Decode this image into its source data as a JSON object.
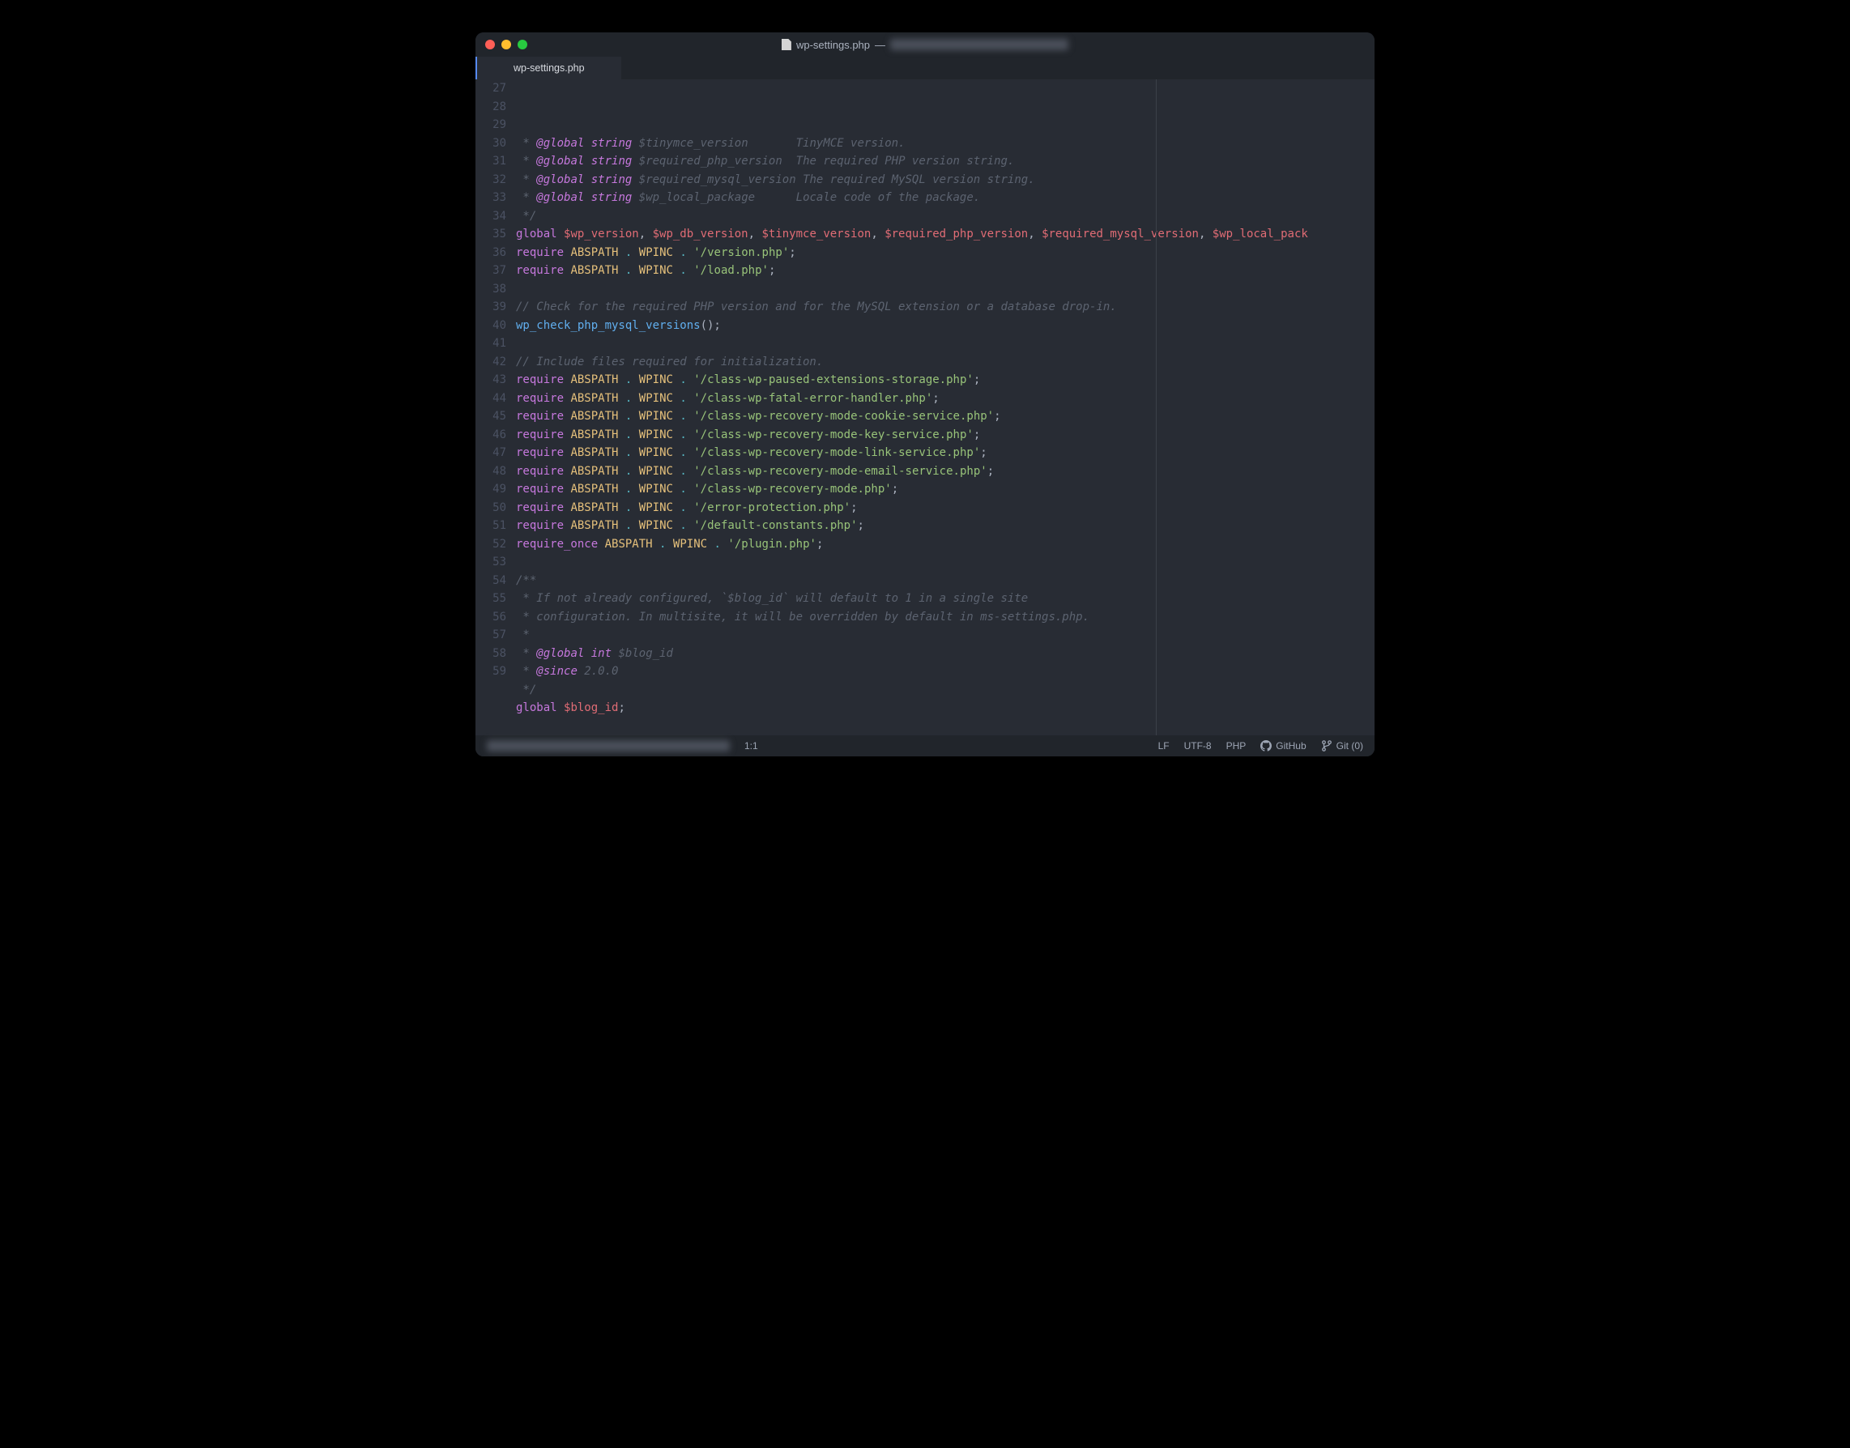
{
  "window": {
    "title_filename": "wp-settings.php",
    "title_separator": " — "
  },
  "tab": {
    "label": "wp-settings.php"
  },
  "gutter": {
    "start": 27,
    "end": 59
  },
  "code": {
    "lines": [
      {
        "n": 27,
        "tokens": [
          {
            "c": "comment",
            "t": " * "
          },
          {
            "c": "doctag",
            "t": "@global"
          },
          {
            "c": "comment",
            "t": " "
          },
          {
            "c": "type",
            "t": "string"
          },
          {
            "c": "comment",
            "t": " "
          },
          {
            "c": "docvar",
            "t": "$tinymce_version"
          },
          {
            "c": "comment",
            "t": "       TinyMCE version."
          }
        ]
      },
      {
        "n": 28,
        "tokens": [
          {
            "c": "comment",
            "t": " * "
          },
          {
            "c": "doctag",
            "t": "@global"
          },
          {
            "c": "comment",
            "t": " "
          },
          {
            "c": "type",
            "t": "string"
          },
          {
            "c": "comment",
            "t": " "
          },
          {
            "c": "docvar",
            "t": "$required_php_version"
          },
          {
            "c": "comment",
            "t": "  The required PHP version string."
          }
        ]
      },
      {
        "n": 29,
        "tokens": [
          {
            "c": "comment",
            "t": " * "
          },
          {
            "c": "doctag",
            "t": "@global"
          },
          {
            "c": "comment",
            "t": " "
          },
          {
            "c": "type",
            "t": "string"
          },
          {
            "c": "comment",
            "t": " "
          },
          {
            "c": "docvar",
            "t": "$required_mysql_version"
          },
          {
            "c": "comment",
            "t": " The required MySQL version string."
          }
        ]
      },
      {
        "n": 30,
        "tokens": [
          {
            "c": "comment",
            "t": " * "
          },
          {
            "c": "doctag",
            "t": "@global"
          },
          {
            "c": "comment",
            "t": " "
          },
          {
            "c": "type",
            "t": "string"
          },
          {
            "c": "comment",
            "t": " "
          },
          {
            "c": "docvar",
            "t": "$wp_local_package"
          },
          {
            "c": "comment",
            "t": "      Locale code of the package."
          }
        ]
      },
      {
        "n": 31,
        "tokens": [
          {
            "c": "comment",
            "t": " */"
          }
        ]
      },
      {
        "n": 32,
        "tokens": [
          {
            "c": "keyword",
            "t": "global"
          },
          {
            "c": "normal",
            "t": " "
          },
          {
            "c": "var",
            "t": "$wp_version"
          },
          {
            "c": "punct",
            "t": ", "
          },
          {
            "c": "var",
            "t": "$wp_db_version"
          },
          {
            "c": "punct",
            "t": ", "
          },
          {
            "c": "var",
            "t": "$tinymce_version"
          },
          {
            "c": "punct",
            "t": ", "
          },
          {
            "c": "var",
            "t": "$required_php_version"
          },
          {
            "c": "punct",
            "t": ", "
          },
          {
            "c": "var",
            "t": "$required_mysql_version"
          },
          {
            "c": "punct",
            "t": ", "
          },
          {
            "c": "var",
            "t": "$wp_local_pack"
          }
        ]
      },
      {
        "n": 33,
        "tokens": [
          {
            "c": "keyword",
            "t": "require"
          },
          {
            "c": "normal",
            "t": " "
          },
          {
            "c": "const",
            "t": "ABSPATH"
          },
          {
            "c": "normal",
            "t": " "
          },
          {
            "c": "op",
            "t": "."
          },
          {
            "c": "normal",
            "t": " "
          },
          {
            "c": "const",
            "t": "WPINC"
          },
          {
            "c": "normal",
            "t": " "
          },
          {
            "c": "op",
            "t": "."
          },
          {
            "c": "normal",
            "t": " "
          },
          {
            "c": "string",
            "t": "'/version.php'"
          },
          {
            "c": "punct",
            "t": ";"
          }
        ]
      },
      {
        "n": 34,
        "tokens": [
          {
            "c": "keyword",
            "t": "require"
          },
          {
            "c": "normal",
            "t": " "
          },
          {
            "c": "const",
            "t": "ABSPATH"
          },
          {
            "c": "normal",
            "t": " "
          },
          {
            "c": "op",
            "t": "."
          },
          {
            "c": "normal",
            "t": " "
          },
          {
            "c": "const",
            "t": "WPINC"
          },
          {
            "c": "normal",
            "t": " "
          },
          {
            "c": "op",
            "t": "."
          },
          {
            "c": "normal",
            "t": " "
          },
          {
            "c": "string",
            "t": "'/load.php'"
          },
          {
            "c": "punct",
            "t": ";"
          }
        ]
      },
      {
        "n": 35,
        "tokens": []
      },
      {
        "n": 36,
        "tokens": [
          {
            "c": "comment",
            "t": "// Check for the required PHP version and for the MySQL extension or a database drop-in."
          }
        ]
      },
      {
        "n": 37,
        "tokens": [
          {
            "c": "func",
            "t": "wp_check_php_mysql_versions"
          },
          {
            "c": "punct",
            "t": "();"
          }
        ]
      },
      {
        "n": 38,
        "tokens": []
      },
      {
        "n": 39,
        "tokens": [
          {
            "c": "comment",
            "t": "// Include files required for initialization."
          }
        ]
      },
      {
        "n": 40,
        "tokens": [
          {
            "c": "keyword",
            "t": "require"
          },
          {
            "c": "normal",
            "t": " "
          },
          {
            "c": "const",
            "t": "ABSPATH"
          },
          {
            "c": "normal",
            "t": " "
          },
          {
            "c": "op",
            "t": "."
          },
          {
            "c": "normal",
            "t": " "
          },
          {
            "c": "const",
            "t": "WPINC"
          },
          {
            "c": "normal",
            "t": " "
          },
          {
            "c": "op",
            "t": "."
          },
          {
            "c": "normal",
            "t": " "
          },
          {
            "c": "string",
            "t": "'/class-wp-paused-extensions-storage.php'"
          },
          {
            "c": "punct",
            "t": ";"
          }
        ]
      },
      {
        "n": 41,
        "tokens": [
          {
            "c": "keyword",
            "t": "require"
          },
          {
            "c": "normal",
            "t": " "
          },
          {
            "c": "const",
            "t": "ABSPATH"
          },
          {
            "c": "normal",
            "t": " "
          },
          {
            "c": "op",
            "t": "."
          },
          {
            "c": "normal",
            "t": " "
          },
          {
            "c": "const",
            "t": "WPINC"
          },
          {
            "c": "normal",
            "t": " "
          },
          {
            "c": "op",
            "t": "."
          },
          {
            "c": "normal",
            "t": " "
          },
          {
            "c": "string",
            "t": "'/class-wp-fatal-error-handler.php'"
          },
          {
            "c": "punct",
            "t": ";"
          }
        ]
      },
      {
        "n": 42,
        "tokens": [
          {
            "c": "keyword",
            "t": "require"
          },
          {
            "c": "normal",
            "t": " "
          },
          {
            "c": "const",
            "t": "ABSPATH"
          },
          {
            "c": "normal",
            "t": " "
          },
          {
            "c": "op",
            "t": "."
          },
          {
            "c": "normal",
            "t": " "
          },
          {
            "c": "const",
            "t": "WPINC"
          },
          {
            "c": "normal",
            "t": " "
          },
          {
            "c": "op",
            "t": "."
          },
          {
            "c": "normal",
            "t": " "
          },
          {
            "c": "string",
            "t": "'/class-wp-recovery-mode-cookie-service.php'"
          },
          {
            "c": "punct",
            "t": ";"
          }
        ]
      },
      {
        "n": 43,
        "tokens": [
          {
            "c": "keyword",
            "t": "require"
          },
          {
            "c": "normal",
            "t": " "
          },
          {
            "c": "const",
            "t": "ABSPATH"
          },
          {
            "c": "normal",
            "t": " "
          },
          {
            "c": "op",
            "t": "."
          },
          {
            "c": "normal",
            "t": " "
          },
          {
            "c": "const",
            "t": "WPINC"
          },
          {
            "c": "normal",
            "t": " "
          },
          {
            "c": "op",
            "t": "."
          },
          {
            "c": "normal",
            "t": " "
          },
          {
            "c": "string",
            "t": "'/class-wp-recovery-mode-key-service.php'"
          },
          {
            "c": "punct",
            "t": ";"
          }
        ]
      },
      {
        "n": 44,
        "tokens": [
          {
            "c": "keyword",
            "t": "require"
          },
          {
            "c": "normal",
            "t": " "
          },
          {
            "c": "const",
            "t": "ABSPATH"
          },
          {
            "c": "normal",
            "t": " "
          },
          {
            "c": "op",
            "t": "."
          },
          {
            "c": "normal",
            "t": " "
          },
          {
            "c": "const",
            "t": "WPINC"
          },
          {
            "c": "normal",
            "t": " "
          },
          {
            "c": "op",
            "t": "."
          },
          {
            "c": "normal",
            "t": " "
          },
          {
            "c": "string",
            "t": "'/class-wp-recovery-mode-link-service.php'"
          },
          {
            "c": "punct",
            "t": ";"
          }
        ]
      },
      {
        "n": 45,
        "tokens": [
          {
            "c": "keyword",
            "t": "require"
          },
          {
            "c": "normal",
            "t": " "
          },
          {
            "c": "const",
            "t": "ABSPATH"
          },
          {
            "c": "normal",
            "t": " "
          },
          {
            "c": "op",
            "t": "."
          },
          {
            "c": "normal",
            "t": " "
          },
          {
            "c": "const",
            "t": "WPINC"
          },
          {
            "c": "normal",
            "t": " "
          },
          {
            "c": "op",
            "t": "."
          },
          {
            "c": "normal",
            "t": " "
          },
          {
            "c": "string",
            "t": "'/class-wp-recovery-mode-email-service.php'"
          },
          {
            "c": "punct",
            "t": ";"
          }
        ]
      },
      {
        "n": 46,
        "tokens": [
          {
            "c": "keyword",
            "t": "require"
          },
          {
            "c": "normal",
            "t": " "
          },
          {
            "c": "const",
            "t": "ABSPATH"
          },
          {
            "c": "normal",
            "t": " "
          },
          {
            "c": "op",
            "t": "."
          },
          {
            "c": "normal",
            "t": " "
          },
          {
            "c": "const",
            "t": "WPINC"
          },
          {
            "c": "normal",
            "t": " "
          },
          {
            "c": "op",
            "t": "."
          },
          {
            "c": "normal",
            "t": " "
          },
          {
            "c": "string",
            "t": "'/class-wp-recovery-mode.php'"
          },
          {
            "c": "punct",
            "t": ";"
          }
        ]
      },
      {
        "n": 47,
        "tokens": [
          {
            "c": "keyword",
            "t": "require"
          },
          {
            "c": "normal",
            "t": " "
          },
          {
            "c": "const",
            "t": "ABSPATH"
          },
          {
            "c": "normal",
            "t": " "
          },
          {
            "c": "op",
            "t": "."
          },
          {
            "c": "normal",
            "t": " "
          },
          {
            "c": "const",
            "t": "WPINC"
          },
          {
            "c": "normal",
            "t": " "
          },
          {
            "c": "op",
            "t": "."
          },
          {
            "c": "normal",
            "t": " "
          },
          {
            "c": "string",
            "t": "'/error-protection.php'"
          },
          {
            "c": "punct",
            "t": ";"
          }
        ]
      },
      {
        "n": 48,
        "tokens": [
          {
            "c": "keyword",
            "t": "require"
          },
          {
            "c": "normal",
            "t": " "
          },
          {
            "c": "const",
            "t": "ABSPATH"
          },
          {
            "c": "normal",
            "t": " "
          },
          {
            "c": "op",
            "t": "."
          },
          {
            "c": "normal",
            "t": " "
          },
          {
            "c": "const",
            "t": "WPINC"
          },
          {
            "c": "normal",
            "t": " "
          },
          {
            "c": "op",
            "t": "."
          },
          {
            "c": "normal",
            "t": " "
          },
          {
            "c": "string",
            "t": "'/default-constants.php'"
          },
          {
            "c": "punct",
            "t": ";"
          }
        ]
      },
      {
        "n": 49,
        "tokens": [
          {
            "c": "keyword",
            "t": "require_once"
          },
          {
            "c": "normal",
            "t": " "
          },
          {
            "c": "const",
            "t": "ABSPATH"
          },
          {
            "c": "normal",
            "t": " "
          },
          {
            "c": "op",
            "t": "."
          },
          {
            "c": "normal",
            "t": " "
          },
          {
            "c": "const",
            "t": "WPINC"
          },
          {
            "c": "normal",
            "t": " "
          },
          {
            "c": "op",
            "t": "."
          },
          {
            "c": "normal",
            "t": " "
          },
          {
            "c": "string",
            "t": "'/plugin.php'"
          },
          {
            "c": "punct",
            "t": ";"
          }
        ]
      },
      {
        "n": 50,
        "tokens": []
      },
      {
        "n": 51,
        "tokens": [
          {
            "c": "comment",
            "t": "/**"
          }
        ]
      },
      {
        "n": 52,
        "tokens": [
          {
            "c": "comment",
            "t": " * If not already configured, `$blog_id` will default to 1 in a single site"
          }
        ]
      },
      {
        "n": 53,
        "tokens": [
          {
            "c": "comment",
            "t": " * configuration. In multisite, it will be overridden by default in ms-settings.php."
          }
        ]
      },
      {
        "n": 54,
        "tokens": [
          {
            "c": "comment",
            "t": " *"
          }
        ]
      },
      {
        "n": 55,
        "tokens": [
          {
            "c": "comment",
            "t": " * "
          },
          {
            "c": "doctag",
            "t": "@global"
          },
          {
            "c": "comment",
            "t": " "
          },
          {
            "c": "type",
            "t": "int"
          },
          {
            "c": "comment",
            "t": " "
          },
          {
            "c": "docvar",
            "t": "$blog_id"
          }
        ]
      },
      {
        "n": 56,
        "tokens": [
          {
            "c": "comment",
            "t": " * "
          },
          {
            "c": "doctag",
            "t": "@since"
          },
          {
            "c": "comment",
            "t": " 2.0.0"
          }
        ]
      },
      {
        "n": 57,
        "tokens": [
          {
            "c": "comment",
            "t": " */"
          }
        ]
      },
      {
        "n": 58,
        "tokens": [
          {
            "c": "keyword",
            "t": "global"
          },
          {
            "c": "normal",
            "t": " "
          },
          {
            "c": "var",
            "t": "$blog_id"
          },
          {
            "c": "punct",
            "t": ";"
          }
        ]
      },
      {
        "n": 59,
        "tokens": []
      }
    ]
  },
  "statusbar": {
    "cursor": "1:1",
    "line_ending": "LF",
    "encoding": "UTF-8",
    "language": "PHP",
    "github": "GitHub",
    "git": "Git (0)"
  }
}
